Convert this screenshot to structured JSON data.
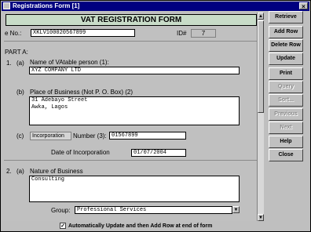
{
  "window": {
    "title": "Registrations Form [1]",
    "close_glyph": "×"
  },
  "form": {
    "heading": "VAT REGISTRATION FORM",
    "ref_label": "e No.:",
    "ref_value": "XKLV100020567899",
    "id_label": "ID#",
    "id_value": "7",
    "part_a": "PART A:",
    "q1_num": "1.",
    "q1a_marker": "(a)",
    "q1a_label": "Name of VAtable person (1):",
    "q1a_value": "XYZ COMPANY LTD",
    "q1b_marker": "(b)",
    "q1b_label": "Place of Business (Not P. O. Box) (2)",
    "q1b_value": "31 Adebayo Street\nAwka, Lagos",
    "q1c_marker": "(c)",
    "q1c_type": "Incorporation",
    "q1c_label": "Number (3):",
    "q1c_value": "01567899",
    "q1c_date_label": "Date of Incorporation",
    "q1c_date_value": "01/07/2004",
    "q2_num": "2.",
    "q2a_marker": "(a)",
    "q2a_label": "Nature of Business",
    "q2a_value": "Consulting",
    "group_label": "Group:",
    "group_value": "Professional Services"
  },
  "side_buttons": [
    {
      "label": "Retrieve",
      "enabled": true
    },
    {
      "label": "Add Row",
      "enabled": true
    },
    {
      "label": "Delete Row",
      "enabled": true
    },
    {
      "label": "Update",
      "enabled": true
    },
    {
      "label": "Print",
      "enabled": true
    },
    {
      "label": "Query",
      "enabled": false
    },
    {
      "label": "Sort...",
      "enabled": false
    },
    {
      "label": "Previous",
      "enabled": false
    },
    {
      "label": "Next",
      "enabled": false
    },
    {
      "label": "Help",
      "enabled": true
    },
    {
      "label": "Close",
      "enabled": true
    }
  ],
  "bottom_checkbox": {
    "label": "Automatically Update and then Add Row at end of form",
    "checked": true,
    "mark": "✓"
  },
  "scroll_glyphs": {
    "up": "▲",
    "down": "▼",
    "combo": "▼"
  }
}
